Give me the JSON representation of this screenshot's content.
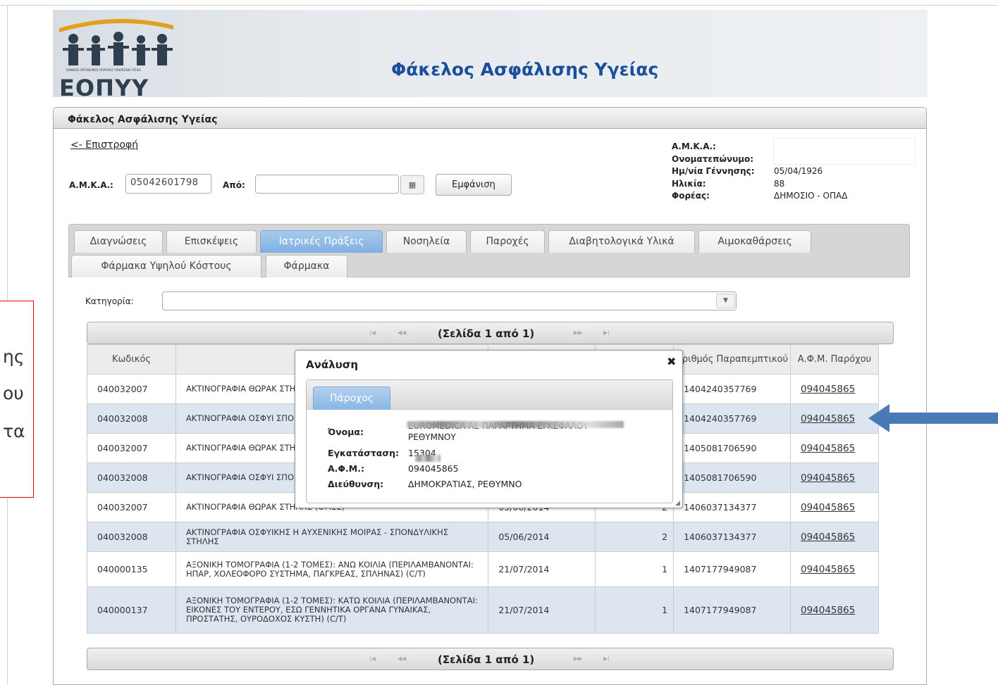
{
  "header": {
    "app_title": "Φάκελος Ασφάλισης Υγείας",
    "logo_text": "ΕΟΠΥΥ",
    "logo_subtext": "ΕΘΝΙΚΟΣ ΟΡΓΑΝΙΣΜΟΣ ΠΑΡΟΧΗΣ ΥΠΗΡΕΣΙΩΝ ΥΓΕΙΑΣ"
  },
  "panel": {
    "title": "Φάκελος Ασφάλισης Υγείας",
    "back_link": "<- Επιστροφή"
  },
  "search": {
    "amka_label": "Α.Μ.Κ.Α.:",
    "amka_value": "05042601798",
    "from_label": "Από:",
    "from_value": "",
    "show_button": "Εμφάνιση"
  },
  "patient": {
    "amka_label": "Α.Μ.Κ.Α.:",
    "name_label": "Ονοματεπώνυμο:",
    "dob_label": "Ημ/νία Γέννησης:",
    "dob_value": "05/04/1926",
    "age_label": "Ηλικία:",
    "age_value": "88",
    "fund_label": "Φορέας:",
    "fund_value": "ΔΗΜΟΣΙΟ - ΟΠΑΔ"
  },
  "tabs": {
    "t0": "Διαγνώσεις",
    "t1": "Επισκέψεις",
    "t2": "Ιατρικές Πράξεις",
    "t3": "Νοσηλεία",
    "t4": "Παροχές",
    "t5": "Διαβητολογικά Υλικά",
    "t6": "Αιμοκαθάρσεις",
    "t7": "Φάρμακα Υψηλού Κόστους",
    "t8": "Φάρμακα"
  },
  "category": {
    "label": "Κατηγορία:",
    "value": ""
  },
  "pager": {
    "text": "(Σελίδα 1 από 1)"
  },
  "table": {
    "headers": {
      "code": "Κωδικός",
      "ref": "Αριθμός Παραπεμπτικού",
      "afm": "Α.Φ.Μ. Παρόχου"
    },
    "rows": [
      {
        "code": "040032007",
        "desc": "ΑΚΤΙΝΟΓΡΑΦΙΑ ΘΩΡΑΚ ΣΤΗΛΗΣ (ΘΜΣΣ)",
        "date": "",
        "qty": "",
        "ref": "1404240357769",
        "afm": "094045865"
      },
      {
        "code": "040032008",
        "desc": "ΑΚΤΙΝΟΓΡΑΦΙΑ ΟΣΦΥΙ ΣΠΟΝΔΥΛΙΚΗΣ ΣΤΗΛΗΣ",
        "date": "",
        "qty": "",
        "ref": "1404240357769",
        "afm": "094045865"
      },
      {
        "code": "040032007",
        "desc": "ΑΚΤΙΝΟΓΡΑΦΙΑ ΘΩΡΑΚ ΣΤΗΛΗΣ (ΘΜΣΣ)",
        "date": "",
        "qty": "",
        "ref": "1405081706590",
        "afm": "094045865"
      },
      {
        "code": "040032008",
        "desc": "ΑΚΤΙΝΟΓΡΑΦΙΑ ΟΣΦΥΙ ΣΠΟΝΔΥΛΙΚΗΣ ΣΤΗΛΗΣ",
        "date": "",
        "qty": "",
        "ref": "1405081706590",
        "afm": "094045865"
      },
      {
        "code": "040032007",
        "desc": "ΑΚΤΙΝΟΓΡΑΦΙΑ ΘΩΡΑΚ ΣΤΗΛΗΣ (ΘΜΣΣ)",
        "date": "05/06/2014",
        "qty": "2",
        "ref": "1406037134377",
        "afm": "094045865"
      },
      {
        "code": "040032008",
        "desc": "ΑΚΤΙΝΟΓΡΑΦΙΑ ΟΣΦΥΙΚΗΣ Η ΑΥΧΕΝΙΚΗΣ ΜΟΙΡΑΣ - ΣΠΟΝΔΥΛΙΚΗΣ ΣΤΗΛΗΣ",
        "date": "05/06/2014",
        "qty": "2",
        "ref": "1406037134377",
        "afm": "094045865"
      },
      {
        "code": "040000135",
        "desc": "ΑΞΟΝΙΚΗ ΤΟΜΟΓΡΑΦΙΑ (1-2 ΤΟΜΕΣ): ΑΝΩ ΚΟΙΛΙΑ (ΠΕΡΙΛΑΜΒΑΝΟΝΤΑΙ: ΗΠΑΡ, ΧΟΛΕΟΦΟΡΟ ΣΥΣΤΗΜΑ, ΠΑΓΚΡΕΑΣ, ΣΠΛΗΝΑΣ) (C/T)",
        "date": "21/07/2014",
        "qty": "1",
        "ref": "1407177949087",
        "afm": "094045865"
      },
      {
        "code": "040000137",
        "desc": "ΑΞΟΝΙΚΗ ΤΟΜΟΓΡΑΦΙΑ (1-2 ΤΟΜΕΣ): ΚΑΤΩ ΚΟΙΛΙΑ (ΠΕΡΙΛΑΜΒΑΝΟΝΤΑΙ: ΕΙΚΟΝΕΣ ΤΟΥ ΕΝΤΕΡΟΥ, ΕΣΩ ΓΕΝΝΗΤΙΚΑ ΟΡΓΑΝΑ ΓΥΝΑΙΚΑΣ, ΠΡΟΣΤΑΤΗΣ, ΟΥΡΟΔΟΧΟΣ ΚΥΣΤΗ) (C/T)",
        "date": "21/07/2014",
        "qty": "1",
        "ref": "1407177949087",
        "afm": "094045865"
      }
    ]
  },
  "modal": {
    "title": "Ανάλυση",
    "tab": "Πάροχος",
    "name_label": "Όνομα:",
    "name_value_line1": "EUROMEDICA AE ΠΑΡΑΡΤΗΜΑ ΕΓΚΕΦΑΛΟΥ",
    "name_value_line2": "ΡΕΘΥΜΝΟΥ",
    "facility_label": "Εγκατάσταση:",
    "facility_value": "15304",
    "afm_label": "Α.Φ.Μ.:",
    "afm_value": "094045865",
    "address_label": "Διεύθυνση:",
    "address_value": "ΔΗΜΟΚΡΑΤΙΑΣ, ΡΕΘΥΜΝΟ"
  },
  "callout": {
    "line1": "ης",
    "line2": "ου",
    "line3": "τα"
  },
  "colors": {
    "accent": "#1c4f9b",
    "tab_active": "#7eb0e2",
    "row_alt": "#dde6f0",
    "arrow": "#4a7ab5",
    "callout_border": "#dd0000"
  }
}
